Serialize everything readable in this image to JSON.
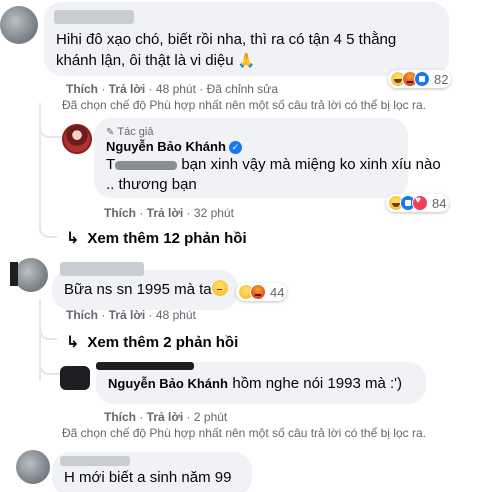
{
  "comment1": {
    "text_line1": "Hihi đô xạo chó, biết rồi nha, thì ra có tận 4 5 thằng",
    "text_line2": "khánh lận, ôi thật là vi diệu",
    "pray_emoji": "🙏",
    "like": "Thích",
    "reply": "Trả lời",
    "time": "48 phút",
    "edited": "Đã chỉnh sửa",
    "reaction_count": "82",
    "reactions": [
      "haha",
      "angry",
      "like"
    ]
  },
  "filter_note_1": "Đã chọn chế độ Phù hợp nhất nên một số câu trả lời có thể bị lọc ra.",
  "reply1": {
    "author_tag": "Tác giả",
    "name": "Nguyễn Bảo Khánh",
    "prefix": "T",
    "text_line1": "bạn xinh vậy mà miệng ko xinh xíu nào",
    "text_line2": ".. thương bạn",
    "like": "Thích",
    "reply": "Trả lời",
    "time": "32 phút",
    "reaction_count": "84",
    "reactions": [
      "haha",
      "like",
      "love"
    ]
  },
  "view_more_1": "Xem thêm 12 phản hồi",
  "comment2": {
    "text": "Bữa ns sn 1995 mà ta",
    "like": "Thích",
    "reply": "Trả lời",
    "time": "48 phút",
    "reaction_count": "44",
    "reactions": [
      "wow",
      "angry"
    ]
  },
  "view_more_2": "Xem thêm 2 phản hồi",
  "reply2": {
    "name": "Nguyễn Bảo Khánh",
    "text": "hồm nghe nói 1993 mà :')",
    "like": "Thích",
    "reply": "Trả lời",
    "time": "2 phút"
  },
  "filter_note_2": "Đã chọn chế độ Phù hợp nhất nên một số câu trả lời có thể bị lọc ra.",
  "comment3": {
    "text": "H mới biết a sinh năm 99"
  },
  "colors": {
    "bubble": "#f0f2f5",
    "meta": "#65676b",
    "verified": "#1877f2",
    "redaction": "#1c1e21"
  }
}
